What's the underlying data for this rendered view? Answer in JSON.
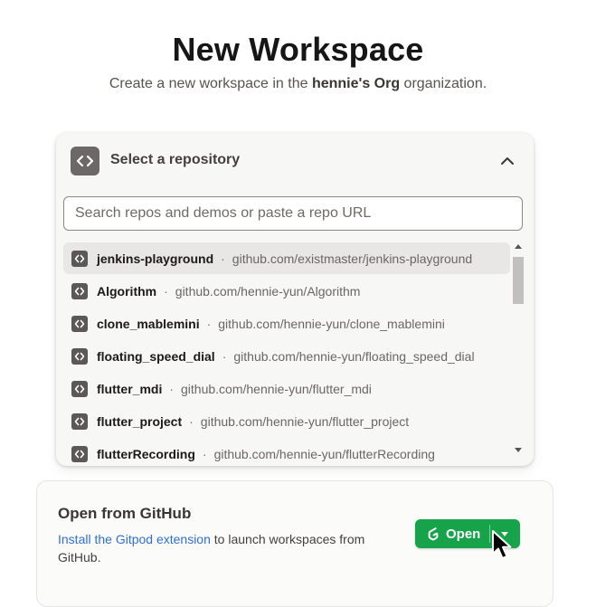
{
  "page": {
    "title": "New Workspace",
    "subtitle_prefix": "Create a new workspace in the ",
    "org_name": "hennie's Org",
    "subtitle_suffix": " organization."
  },
  "repo_selector": {
    "header_label": "Select a repository",
    "header_icon": "code-brackets-icon",
    "collapse_icon": "chevron-up-icon",
    "search_placeholder": "Search repos and demos or paste a repo URL",
    "search_value": "",
    "separator": "·",
    "items": [
      {
        "name": "jenkins-playground",
        "url": "github.com/existmaster/jenkins-playground"
      },
      {
        "name": "Algorithm",
        "url": "github.com/hennie-yun/Algorithm"
      },
      {
        "name": "clone_mablemini",
        "url": "github.com/hennie-yun/clone_mablemini"
      },
      {
        "name": "floating_speed_dial",
        "url": "github.com/hennie-yun/floating_speed_dial"
      },
      {
        "name": "flutter_mdi",
        "url": "github.com/hennie-yun/flutter_mdi"
      },
      {
        "name": "flutter_project",
        "url": "github.com/hennie-yun/flutter_project"
      },
      {
        "name": "flutterRecording",
        "url": "github.com/hennie-yun/flutterRecording"
      }
    ]
  },
  "github_card": {
    "title": "Open from GitHub",
    "link_text": "Install the Gitpod extension",
    "desc_suffix": " to launch workspaces from GitHub.",
    "open_label": "Open",
    "open_icon": "gitpod-logo-icon",
    "dropdown_icon": "caret-down-icon"
  },
  "colors": {
    "accent_green": "#16a34a",
    "link_blue": "#2f6fd6",
    "icon_gray": "#5b5855"
  }
}
